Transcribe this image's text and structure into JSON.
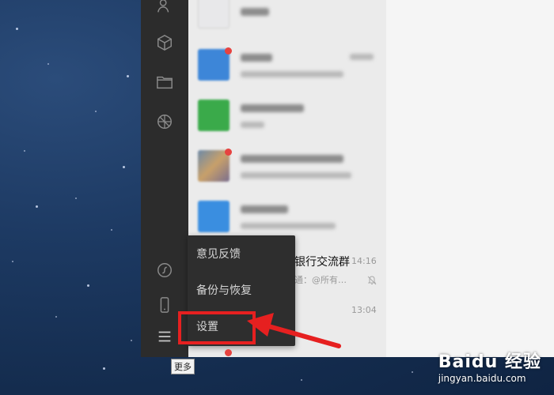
{
  "sidebar": {
    "icons": [
      "contacts-icon",
      "box-icon",
      "folder-icon",
      "moments-icon",
      "mini-program-icon",
      "phone-icon",
      "menu-icon"
    ]
  },
  "chat_list": {
    "visible_chat_title": "银行交流群",
    "visible_chat_time": "14:16",
    "visible_chat_preview": "通：@所有…",
    "visible_time_2": "13:04"
  },
  "popup_menu": {
    "items": [
      "意见反馈",
      "备份与恢复",
      "设置"
    ]
  },
  "tooltip": {
    "label": "更多"
  },
  "watermark": {
    "logo": "Baidu 经验",
    "url": "jingyan.baidu.com"
  },
  "colors": {
    "sidebar_bg": "#2c2c2c",
    "menu_bg": "#2e2e2e",
    "highlight": "#e62020",
    "badge": "#e64340"
  }
}
